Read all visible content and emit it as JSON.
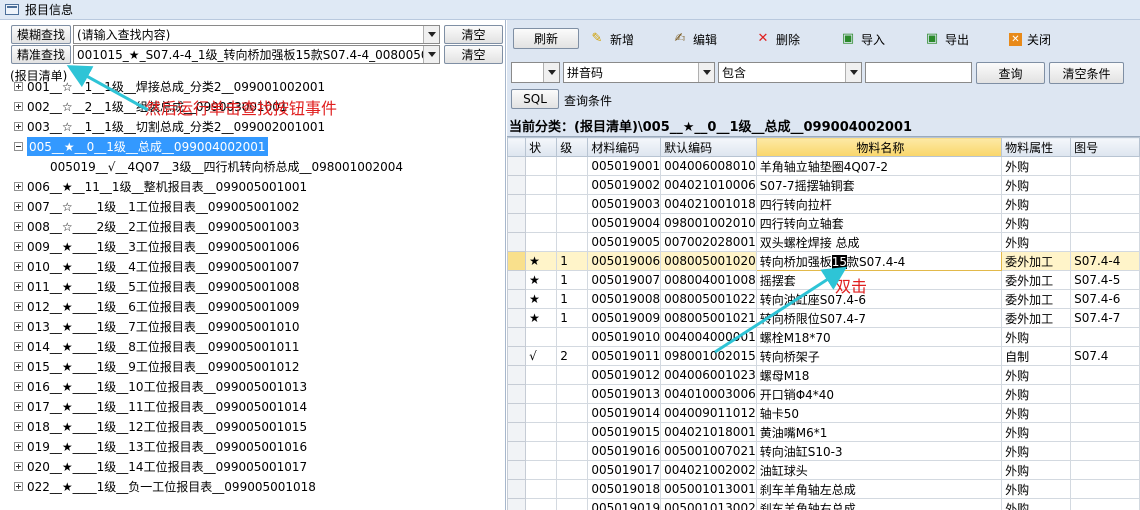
{
  "window": {
    "title": "报目信息"
  },
  "left": {
    "fuzzy_search_btn": "模糊查找",
    "precise_search_btn": "精准查找",
    "search_combo_text": "(请输入查找内容)",
    "precise_combo_text": "001015_★_S07.4-4_1级_转向桥加强板15款S07.4-4_008005001020",
    "clear1": "清空",
    "clear2": "清空",
    "tree_root": "(报目清单)",
    "tree_items": [
      "001__☆__1__1级__焊接总成_分类2__099001002001",
      "002__☆__2__1级__组装总成__099003001001",
      "003__☆__1__1级__切割总成_分类2__099002001001",
      "005__★__0__1级__总成__099004002001",
      "005019__√__4Q07__3级__四行机转向桥总成__098001002004",
      "006__★__11__1级__整机报目表__099005001001",
      "007__☆____1级__1工位报目表__099005001002",
      "008__☆____2级__2工位报目表__099005001003",
      "009__★____1级__3工位报目表__099005001006",
      "010__★____1级__4工位报目表__099005001007",
      "011__★____1级__5工位报目表__099005001008",
      "012__★____1级__6工位报目表__099005001009",
      "013__★____1级__7工位报目表__099005001010",
      "014__★____1级__8工位报目表__099005001011",
      "015__★____1级__9工位报目表__099005001012",
      "016__★____1级__10工位报目表__099005001013",
      "017__★____1级__11工位报目表__099005001014",
      "018__★____1级__12工位报目表__099005001015",
      "019__★____1级__13工位报目表__099005001016",
      "020__★____1级__14工位报目表__099005001017",
      "022__★____1级__负一工位报目表__099005001018"
    ],
    "annotation": "然后运行单击查找按钮事件"
  },
  "toolbar": {
    "refresh": "刷新",
    "add": "新增",
    "edit": "编辑",
    "delete": "删除",
    "import": "导入",
    "export": "导出",
    "close": "关闭"
  },
  "filter": {
    "field": "拼音码",
    "op": "包含",
    "value": "",
    "query_btn": "查询",
    "clear_btn": "清空条件",
    "sql_btn": "SQL",
    "cond_label": "查询条件"
  },
  "category_line": "当前分类：(报目清单)\\005__★__0__1级__总成__099004002001",
  "grid": {
    "columns": [
      "状",
      "级",
      "材料编码",
      "默认编码",
      "物料名称",
      "物料属性",
      "图号"
    ],
    "rows": [
      [
        "",
        "",
        "005019001",
        "004006008010",
        "羊角轴立轴垫圈4Q07-2",
        "外购",
        ""
      ],
      [
        "",
        "",
        "005019002",
        "004021010006",
        "S07-7摇摆轴铜套",
        "外购",
        ""
      ],
      [
        "",
        "",
        "005019003",
        "004021001018",
        "四行转向拉杆",
        "外购",
        ""
      ],
      [
        "",
        "",
        "005019004",
        "098001002010",
        "四行转向立轴套",
        "外购",
        ""
      ],
      [
        "",
        "",
        "005019005",
        "007002028001",
        "双头螺栓焊接 总成",
        "外购",
        ""
      ],
      [
        "★",
        "1",
        "005019006",
        "008005001020",
        "转向桥加强板15款S07.4-4",
        "委外加工",
        "S07.4-4"
      ],
      [
        "★",
        "1",
        "005019007",
        "008004001008",
        "摇摆套",
        "委外加工",
        "S07.4-5"
      ],
      [
        "★",
        "1",
        "005019008",
        "008005001022",
        "转向油缸座S07.4-6",
        "委外加工",
        "S07.4-6"
      ],
      [
        "★",
        "1",
        "005019009",
        "008005001021",
        "转向桥限位S07.4-7",
        "委外加工",
        "S07.4-7"
      ],
      [
        "",
        "",
        "005019010",
        "004004000001",
        "螺栓M18*70",
        "外购",
        ""
      ],
      [
        "√",
        "2",
        "005019011",
        "098001002015",
        "转向桥架子",
        "自制",
        "S07.4"
      ],
      [
        "",
        "",
        "005019012",
        "004006001023",
        "螺母M18",
        "外购",
        ""
      ],
      [
        "",
        "",
        "005019013",
        "004010003006",
        "开口销Φ4*40",
        "外购",
        ""
      ],
      [
        "",
        "",
        "005019014",
        "004009011012",
        "轴卡50",
        "外购",
        ""
      ],
      [
        "",
        "",
        "005019015",
        "004021018001",
        "黄油嘴M6*1",
        "外购",
        ""
      ],
      [
        "",
        "",
        "005019016",
        "005001007021",
        "转向油缸S10-3",
        "外购",
        ""
      ],
      [
        "",
        "",
        "005019017",
        "004021002002",
        "油缸球头",
        "外购",
        ""
      ],
      [
        "",
        "",
        "005019018",
        "005001013001",
        "刹车羊角轴左总成",
        "外购",
        ""
      ],
      [
        "",
        "",
        "005019019",
        "005001013002",
        "刹车羊角轴右总成",
        "外购",
        ""
      ]
    ],
    "current_row_index": 5,
    "annotation": "双击"
  },
  "colors": {
    "accent": "#3399ff",
    "annotation": "#e02020",
    "arrow": "#2ec4d6"
  }
}
